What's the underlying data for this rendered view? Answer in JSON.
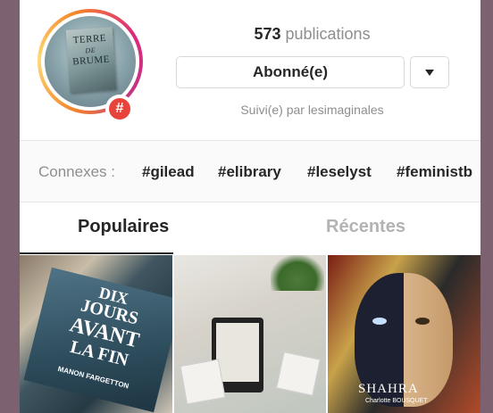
{
  "header": {
    "avatar_book_title": [
      "TERRE",
      "DE",
      "BRUME"
    ],
    "hashtag_badge": "#",
    "post_count": "573",
    "post_count_label": "publications",
    "follow_label": "Abonné(e)",
    "followed_by": "Suivi(e) par lesimaginales"
  },
  "related": {
    "label": "Connexes :",
    "tags": [
      "#gilead",
      "#elibrary",
      "#leselyst",
      "#feministb"
    ]
  },
  "tabs": [
    {
      "label": "Populaires",
      "active": true
    },
    {
      "label": "Récentes",
      "active": false
    }
  ],
  "grid": {
    "tile1": {
      "title_lines": [
        "DIX",
        "JOURS",
        "AVANT",
        "LA FIN"
      ],
      "author": "MANON FARGETTON"
    },
    "tile3": {
      "title": "SHAHRA",
      "author": "Charlotte BOUSQUET"
    }
  },
  "colors": {
    "background": "#7c6170",
    "badge": "#e8433b",
    "text": "#262626",
    "muted": "#8e8e8e"
  },
  "icons": [
    "hashtag-icon",
    "chevron-down-icon"
  ]
}
